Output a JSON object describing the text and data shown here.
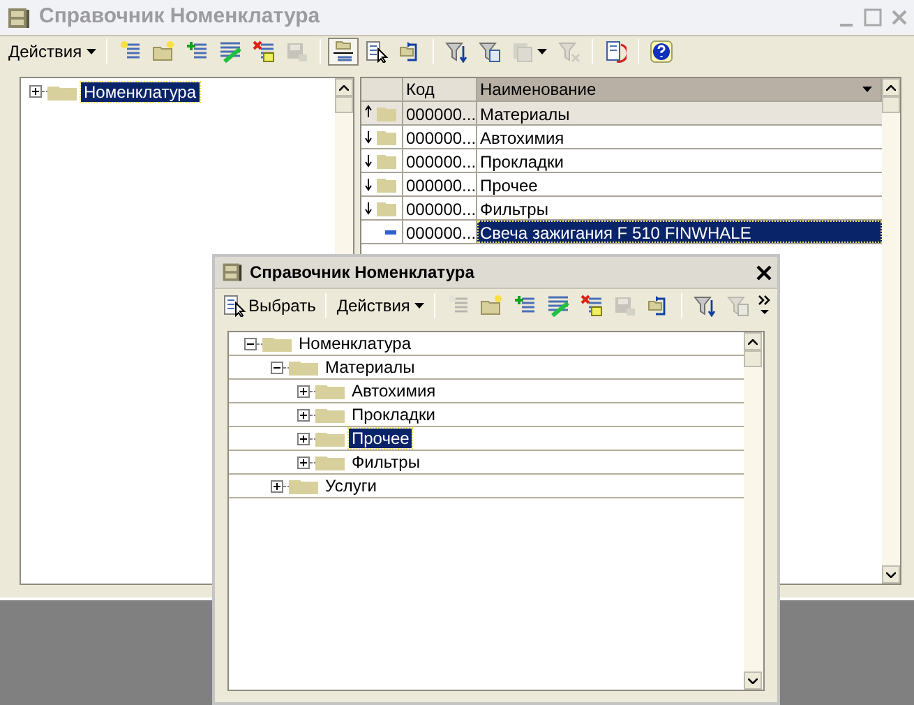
{
  "main_window": {
    "title": "Справочник Номенклатура",
    "toolbar": [
      {
        "kind": "menu",
        "label": "Действия"
      },
      {
        "kind": "separator"
      },
      {
        "kind": "icon",
        "disabled": false,
        "pressed": false
      },
      {
        "kind": "icon",
        "disabled": false,
        "pressed": false
      },
      {
        "kind": "icon",
        "disabled": false,
        "pressed": false
      },
      {
        "kind": "icon",
        "disabled": false,
        "pressed": false
      },
      {
        "kind": "icon",
        "disabled": false,
        "pressed": false
      },
      {
        "kind": "icon",
        "disabled": true,
        "pressed": false
      },
      {
        "kind": "separator"
      },
      {
        "kind": "icon",
        "disabled": false,
        "pressed": true
      },
      {
        "kind": "icon",
        "disabled": false,
        "pressed": false
      },
      {
        "kind": "icon",
        "disabled": false,
        "pressed": false
      },
      {
        "kind": "separator"
      },
      {
        "kind": "icon",
        "disabled": false,
        "pressed": false
      },
      {
        "kind": "icon",
        "disabled": false,
        "pressed": false
      },
      {
        "kind": "icon",
        "disabled": true,
        "pressed": false,
        "dropdown": true
      },
      {
        "kind": "icon",
        "disabled": true,
        "pressed": false
      },
      {
        "kind": "separator"
      },
      {
        "kind": "icon",
        "disabled": false,
        "pressed": false
      },
      {
        "kind": "separator"
      },
      {
        "kind": "icon",
        "disabled": false,
        "pressed": false
      }
    ],
    "tree": [
      {
        "label": "Номенклатура",
        "expanded": false,
        "selected": true
      }
    ],
    "table": {
      "columns": [
        {
          "label": "Код",
          "sorted": false
        },
        {
          "label": "Наименование",
          "sorted": true
        }
      ],
      "rows": [
        {
          "kind": "parent",
          "code": "000000...",
          "name": "Материалы",
          "selected": false
        },
        {
          "kind": "group",
          "code": "000000...",
          "name": "Автохимия",
          "selected": false
        },
        {
          "kind": "group",
          "code": "000000...",
          "name": "Прокладки",
          "selected": false
        },
        {
          "kind": "group",
          "code": "000000...",
          "name": "Прочее",
          "selected": false
        },
        {
          "kind": "group",
          "code": "000000...",
          "name": "Фильтры",
          "selected": false
        },
        {
          "kind": "item",
          "code": "000000...",
          "name": "Свеча зажигания F 510 FINWHALE",
          "selected": true
        }
      ]
    }
  },
  "dialog": {
    "title": "Справочник Номенклатура",
    "toolbar": [
      {
        "kind": "button",
        "label": "Выбрать"
      },
      {
        "kind": "separator"
      },
      {
        "kind": "menu",
        "label": "Действия"
      },
      {
        "kind": "separator"
      },
      {
        "kind": "icon",
        "disabled": true,
        "pressed": false
      },
      {
        "kind": "icon",
        "disabled": false,
        "pressed": false
      },
      {
        "kind": "icon",
        "disabled": false,
        "pressed": false
      },
      {
        "kind": "icon",
        "disabled": false,
        "pressed": false
      },
      {
        "kind": "icon",
        "disabled": false,
        "pressed": false
      },
      {
        "kind": "icon",
        "disabled": true,
        "pressed": false
      },
      {
        "kind": "icon",
        "disabled": false,
        "pressed": false
      },
      {
        "kind": "separator"
      },
      {
        "kind": "icon",
        "disabled": false,
        "pressed": false
      },
      {
        "kind": "icon",
        "disabled": true,
        "pressed": false
      }
    ],
    "tree": [
      {
        "label": "Номенклатура",
        "expanded": true,
        "selected": false,
        "children": [
          {
            "label": "Материалы",
            "expanded": true,
            "selected": false,
            "children": [
              {
                "label": "Автохимия",
                "expanded": false,
                "selected": false
              },
              {
                "label": "Прокладки",
                "expanded": false,
                "selected": false
              },
              {
                "label": "Прочее",
                "expanded": false,
                "selected": true
              },
              {
                "label": "Фильтры",
                "expanded": false,
                "selected": false
              }
            ]
          },
          {
            "label": "Услуги",
            "expanded": false,
            "selected": false
          }
        ]
      }
    ]
  }
}
